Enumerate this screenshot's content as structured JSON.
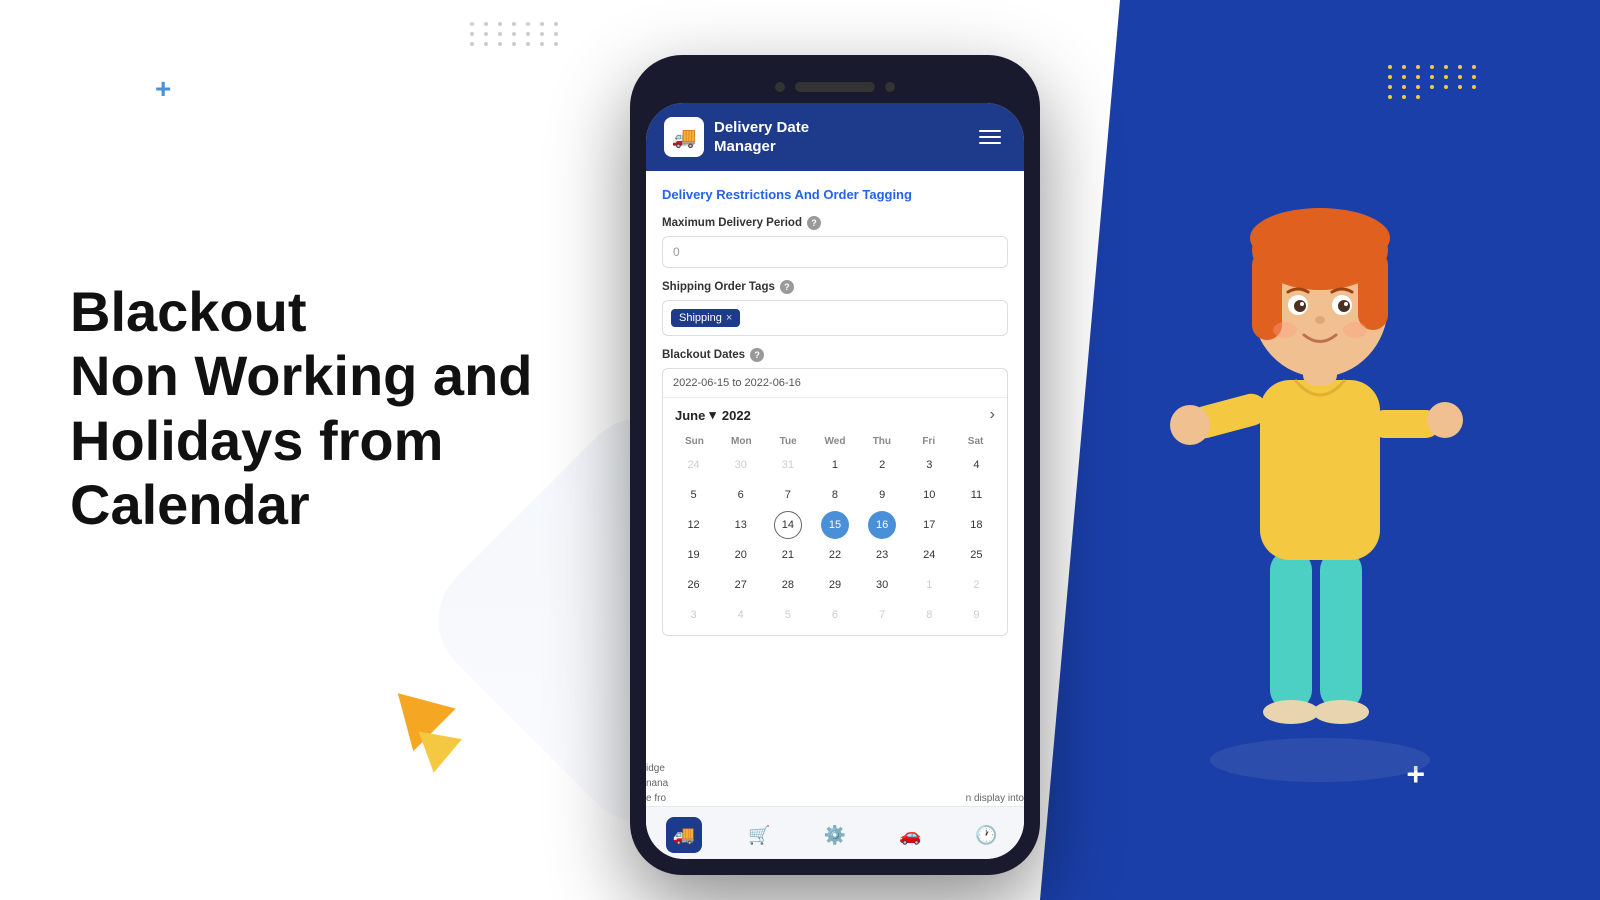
{
  "background": {
    "left_color": "#ffffff",
    "right_color": "#1a3fa8"
  },
  "decorative": {
    "plus_blue": "+",
    "plus_white": "+",
    "triangle_orange_visible": true,
    "triangle_yellow_visible": true
  },
  "headline": {
    "line1": "Blackout",
    "line2": "Non Working and",
    "line3": "Holidays from",
    "line4": "Calendar"
  },
  "app": {
    "title_line1": "Delivery Date",
    "title_line2": "Manager",
    "logo_emoji": "🚚",
    "section_title": "Delivery Restrictions And Order Tagging",
    "max_delivery_label": "Maximum Delivery Period",
    "max_delivery_value": "0",
    "max_delivery_placeholder": "0",
    "shipping_tags_label": "Shipping Order Tags",
    "tag_chip_label": "Shipping",
    "blackout_dates_label": "Blackout Dates",
    "date_range_display": "2022-06-15 to 2022-06-16",
    "calendar": {
      "month": "June",
      "year": "2022",
      "day_headers": [
        "Sun",
        "Mon",
        "Tue",
        "Wed",
        "Thu",
        "Fri",
        "Sat"
      ],
      "weeks": [
        [
          {
            "label": "24",
            "type": "other"
          },
          {
            "label": "30",
            "type": "other"
          },
          {
            "label": "31",
            "type": "other"
          },
          {
            "label": "1",
            "type": "normal"
          },
          {
            "label": "2",
            "type": "normal"
          },
          {
            "label": "3",
            "type": "normal"
          },
          {
            "label": "4",
            "type": "normal"
          }
        ],
        [
          {
            "label": "5",
            "type": "normal"
          },
          {
            "label": "6",
            "type": "normal"
          },
          {
            "label": "7",
            "type": "normal"
          },
          {
            "label": "8",
            "type": "normal"
          },
          {
            "label": "9",
            "type": "normal"
          },
          {
            "label": "10",
            "type": "normal"
          },
          {
            "label": "11",
            "type": "normal"
          }
        ],
        [
          {
            "label": "12",
            "type": "normal"
          },
          {
            "label": "13",
            "type": "normal"
          },
          {
            "label": "14",
            "type": "today"
          },
          {
            "label": "15",
            "type": "selected-start"
          },
          {
            "label": "16",
            "type": "selected-end"
          },
          {
            "label": "17",
            "type": "normal"
          },
          {
            "label": "18",
            "type": "normal"
          }
        ],
        [
          {
            "label": "19",
            "type": "normal"
          },
          {
            "label": "20",
            "type": "normal"
          },
          {
            "label": "21",
            "type": "normal"
          },
          {
            "label": "22",
            "type": "normal"
          },
          {
            "label": "23",
            "type": "normal"
          },
          {
            "label": "24",
            "type": "normal"
          },
          {
            "label": "25",
            "type": "normal"
          }
        ],
        [
          {
            "label": "26",
            "type": "normal"
          },
          {
            "label": "27",
            "type": "normal"
          },
          {
            "label": "28",
            "type": "normal"
          },
          {
            "label": "29",
            "type": "normal"
          },
          {
            "label": "30",
            "type": "normal"
          },
          {
            "label": "1",
            "type": "other"
          },
          {
            "label": "2",
            "type": "other"
          }
        ],
        [
          {
            "label": "3",
            "type": "other"
          },
          {
            "label": "4",
            "type": "other"
          },
          {
            "label": "5",
            "type": "other"
          },
          {
            "label": "6",
            "type": "other"
          },
          {
            "label": "7",
            "type": "other"
          },
          {
            "label": "8",
            "type": "other"
          },
          {
            "label": "9",
            "type": "other"
          }
        ]
      ]
    },
    "bottom_nav": [
      {
        "icon": "🚚",
        "active": true
      },
      {
        "icon": "🛒",
        "active": false
      },
      {
        "icon": "⚙️",
        "active": false
      },
      {
        "icon": "🚗",
        "active": false
      },
      {
        "icon": "🕐",
        "active": false
      }
    ]
  }
}
